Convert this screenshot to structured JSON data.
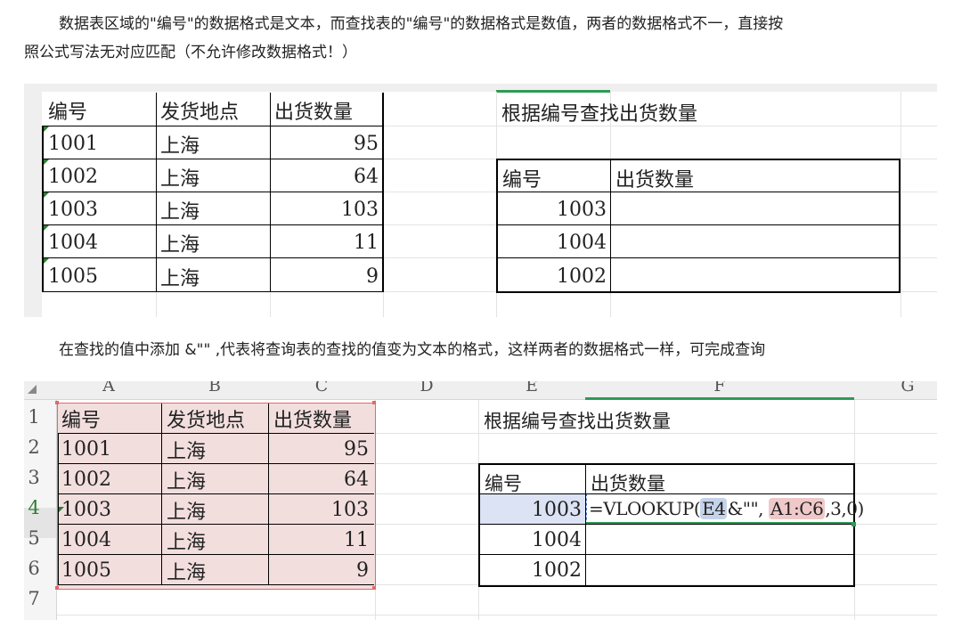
{
  "paragraphs": {
    "p1_line1": "数据表区域的\"编号\"的数据格式是文本，而查找表的\"编号\"的数据格式是数值，两者的数据格式不一，直接按",
    "p1_line2": "照公式写法无对应匹配（不允许修改数据格式！）",
    "p2": "在查找的值中添加 &\"\" ,代表将查询表的查找的值变为文本的格式，这样两者的数据格式一样，可完成查询"
  },
  "sheet1": {
    "headers": [
      "编号",
      "发货地点",
      "出货数量"
    ],
    "rows": [
      {
        "id": "1001",
        "place": "上海",
        "qty": "95"
      },
      {
        "id": "1002",
        "place": "上海",
        "qty": "64"
      },
      {
        "id": "1003",
        "place": "上海",
        "qty": "103"
      },
      {
        "id": "1004",
        "place": "上海",
        "qty": "11"
      },
      {
        "id": "1005",
        "place": "上海",
        "qty": "9"
      }
    ],
    "lookup_title": "根据编号查找出货数量",
    "lookup_headers": [
      "编号",
      "出货数量"
    ],
    "lookup_ids": [
      "1003",
      "1004",
      "1002"
    ]
  },
  "sheet2": {
    "col_headers": [
      "A",
      "B",
      "C",
      "D",
      "E",
      "F",
      "G"
    ],
    "row_headers": [
      "1",
      "2",
      "3",
      "4",
      "5",
      "6",
      "7"
    ],
    "headers": [
      "编号",
      "发货地点",
      "出货数量"
    ],
    "rows": [
      {
        "id": "1001",
        "place": "上海",
        "qty": "95"
      },
      {
        "id": "1002",
        "place": "上海",
        "qty": "64"
      },
      {
        "id": "1003",
        "place": "上海",
        "qty": "103"
      },
      {
        "id": "1004",
        "place": "上海",
        "qty": "11"
      },
      {
        "id": "1005",
        "place": "上海",
        "qty": "9"
      }
    ],
    "lookup_title": "根据编号查找出货数量",
    "lookup_headers": [
      "编号",
      "出货数量"
    ],
    "lookup_ids": [
      "1003",
      "1004",
      "1002"
    ],
    "formula": {
      "prefix": "=VLOOKUP(",
      "ref1": "E4",
      "mid": "&\"\",",
      "ref2": "A1:C6",
      "suffix": ",3,0)"
    }
  },
  "colors": {
    "data_range_fill": "#f3dede",
    "data_range_border": "#e06a6a",
    "active_cell_fill": "#dbe3f4",
    "active_cell_border": "#4a78c8",
    "column_accent": "#2e9a57"
  }
}
